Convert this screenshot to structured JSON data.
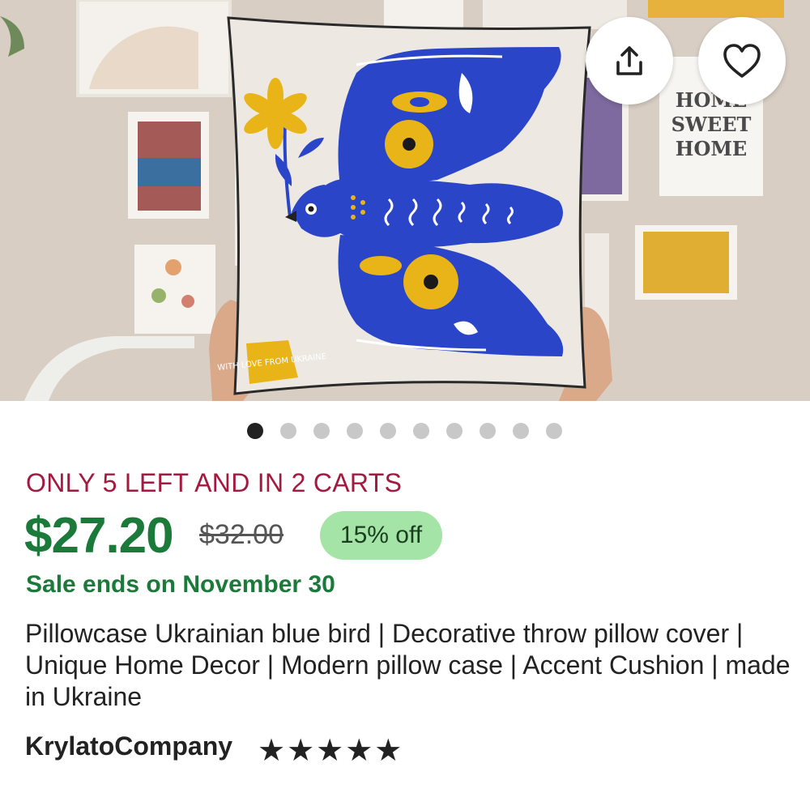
{
  "gallery": {
    "image_count": 10,
    "active_index": 0,
    "pillow_tag_text": "WITH LOVE FROM UKRAINE",
    "poster_text": [
      "HOME",
      "SWEET",
      "HOME"
    ],
    "actions": {
      "share_icon": "share-icon",
      "favorite_icon": "heart-icon"
    }
  },
  "listing": {
    "stock_notice": "ONLY 5 LEFT AND IN 2 CARTS",
    "price": "$27.20",
    "original_price": "$32.00",
    "discount_badge": "15% off",
    "sale_notice": "Sale ends on November 30",
    "title": "Pillowcase Ukrainian blue bird | Decorative throw pillow cover | Unique Home Decor | Modern pillow case | Accent Cushion | made in Ukraine",
    "shop_name": "KrylatoCompany",
    "rating_stars": "★★★★★",
    "rating": 5
  },
  "colors": {
    "price_green": "#1b7a3a",
    "stock_red": "#a3193f",
    "badge_green": "#a4e4a6",
    "bird_blue": "#2a45c8",
    "accent_yellow": "#e8b417"
  }
}
